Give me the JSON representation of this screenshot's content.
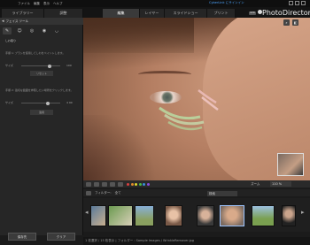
{
  "menu": {
    "items": [
      "ファイル",
      "編集",
      "表示",
      "ヘルプ"
    ],
    "link": "CyberLink にサインイン"
  },
  "brand": {
    "name": "PhotoDirector",
    "badge": "UPD"
  },
  "tabs": [
    {
      "label": "ライブラリー",
      "active": false
    },
    {
      "label": "調整",
      "active": false
    },
    {
      "label": "編集",
      "active": true
    },
    {
      "label": "レイヤー",
      "active": false
    },
    {
      "label": "スライドショー",
      "active": false
    },
    {
      "label": "プリント",
      "active": false
    }
  ],
  "left_panel": {
    "title": "フェイス ツール",
    "section": "しわ取り",
    "hint1": "手順 1: ブラシを使用してしわをペイントします。",
    "hint2": "手順 2: 適切な範囲を参照したい場所をクリックします。",
    "brush_label": "サイズ",
    "brush_value": "100",
    "size_label": "サイズ",
    "size_value": "4 90",
    "reset_label": "リセット",
    "apply_label": "適用"
  },
  "bottom_buttons": {
    "save": "保存先",
    "cancel": "クリア"
  },
  "toolbar": {
    "zoom_label": "ズーム",
    "zoom_value": "110 %",
    "swatch_colors": [
      "#d94040",
      "#e28a2b",
      "#e2d52b",
      "#47b847",
      "#3a8fd9",
      "#8a4bd9"
    ]
  },
  "filterbar": {
    "items": [
      "フィルター:",
      "全て"
    ],
    "search": "検索"
  },
  "status": "1 枚選択 / 15 枚表示  |  フォルダー : Sample Images / WrinkleRemover.jpg"
}
